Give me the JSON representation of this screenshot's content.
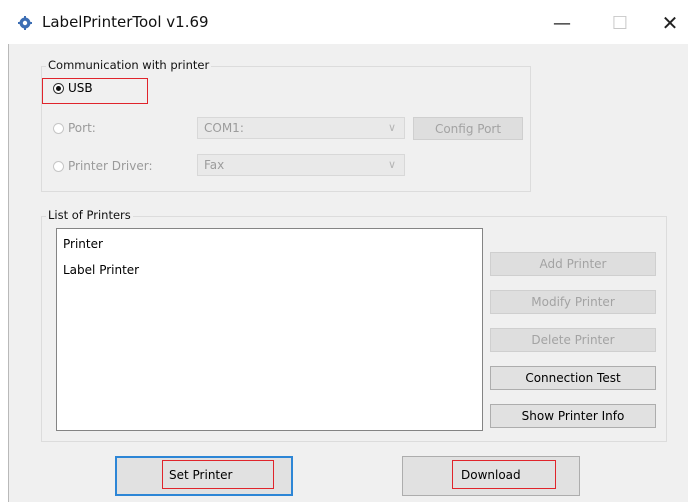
{
  "window": {
    "title": "LabelPrinterTool v1.69",
    "minimize_glyph": "—",
    "maximize_glyph": "☐",
    "close_glyph": "✕",
    "icon": "gear-icon"
  },
  "comm": {
    "group_label": "Communication with printer",
    "usb_label": "USB",
    "port_label": "Port:",
    "port_value": "COM1:",
    "config_port_label": "Config Port",
    "driver_label": "Printer Driver:",
    "driver_value": "Fax",
    "selected": "USB"
  },
  "printers": {
    "group_label": "List of Printers",
    "items": [
      "Printer",
      "Label Printer"
    ],
    "add_label": "Add Printer",
    "modify_label": "Modify Printer",
    "delete_label": "Delete Printer",
    "test_label": "Connection Test",
    "info_label": "Show Printer Info"
  },
  "bottom": {
    "set_printer_label": "Set Printer",
    "download_label": "Download"
  },
  "colors": {
    "highlight": "#e0242b",
    "focus": "#2d86d6"
  }
}
